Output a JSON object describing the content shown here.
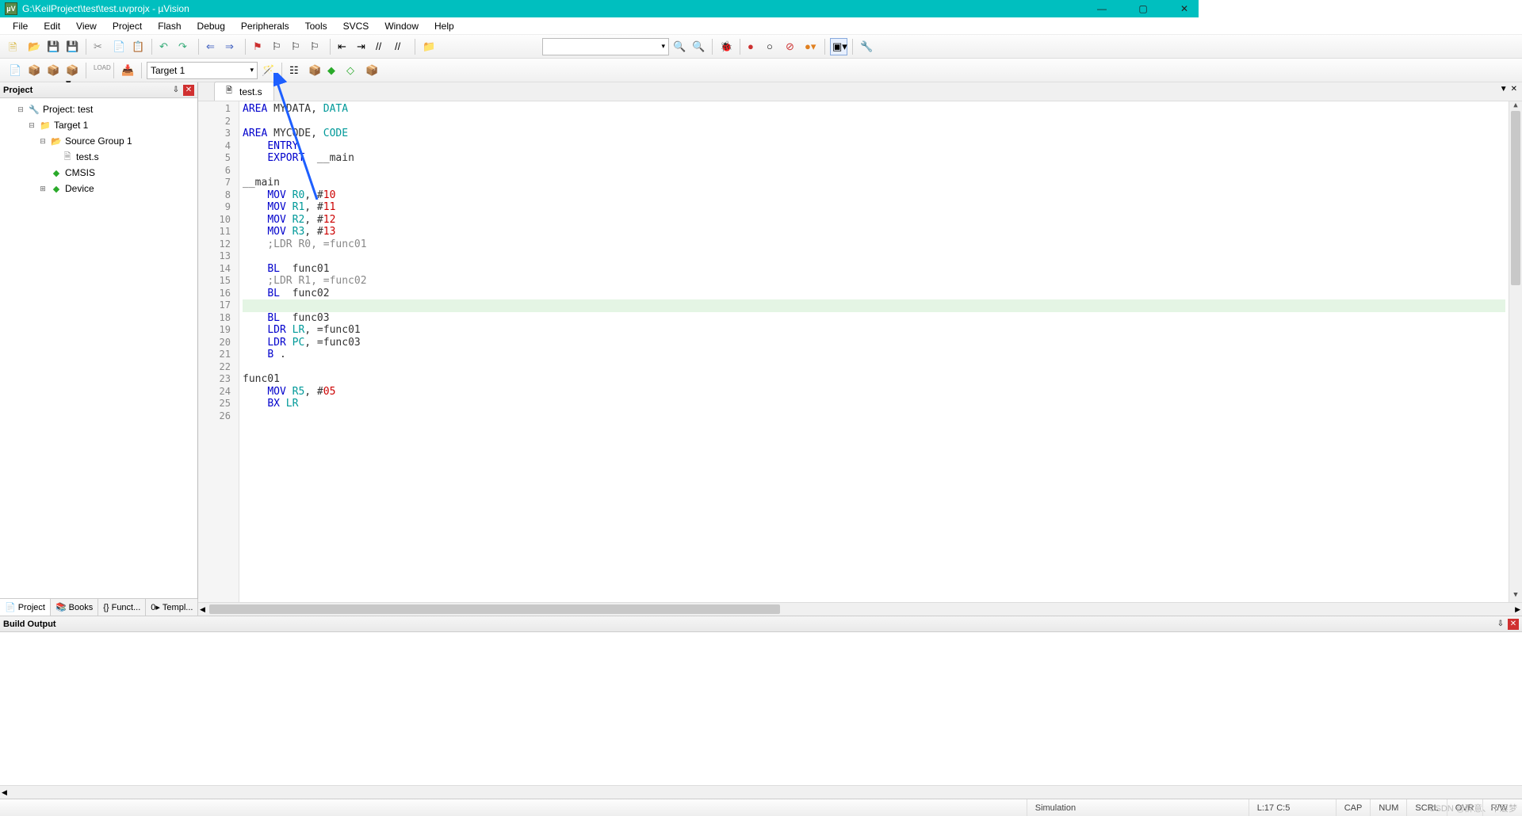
{
  "window": {
    "title": "G:\\KeilProject\\test\\test.uvprojx - µVision",
    "app_icon_label": "µV"
  },
  "menubar": {
    "items": [
      "File",
      "Edit",
      "View",
      "Project",
      "Flash",
      "Debug",
      "Peripherals",
      "Tools",
      "SVCS",
      "Window",
      "Help"
    ]
  },
  "toolbar2": {
    "target_combo": "Target 1"
  },
  "project_panel": {
    "title": "Project",
    "tree_root": "Project: test",
    "target": "Target 1",
    "group": "Source Group 1",
    "file": "test.s",
    "cmsis": "CMSIS",
    "device": "Device",
    "bottom_tabs": [
      "Project",
      "Books",
      "Funct...",
      "Templ..."
    ]
  },
  "editor": {
    "filename": "test.s",
    "highlighted_line": 17,
    "code_lines": [
      {
        "n": 1,
        "segs": [
          {
            "c": "kw-blue",
            "t": "AREA"
          },
          {
            "t": " MYDATA, "
          },
          {
            "c": "kw-teal",
            "t": "DATA"
          }
        ]
      },
      {
        "n": 2,
        "segs": []
      },
      {
        "n": 3,
        "segs": [
          {
            "c": "kw-blue",
            "t": "AREA"
          },
          {
            "t": " MYCODE, "
          },
          {
            "c": "kw-teal",
            "t": "CODE"
          }
        ]
      },
      {
        "n": 4,
        "segs": [
          {
            "t": "    "
          },
          {
            "c": "kw-blue",
            "t": "ENTRY"
          }
        ]
      },
      {
        "n": 5,
        "segs": [
          {
            "t": "    "
          },
          {
            "c": "kw-blue",
            "t": "EXPORT"
          },
          {
            "t": "  __main"
          }
        ]
      },
      {
        "n": 6,
        "segs": []
      },
      {
        "n": 7,
        "segs": [
          {
            "t": "__main"
          }
        ]
      },
      {
        "n": 8,
        "segs": [
          {
            "t": "    "
          },
          {
            "c": "kw-blue",
            "t": "MOV"
          },
          {
            "t": " "
          },
          {
            "c": "kw-teal",
            "t": "R0"
          },
          {
            "t": ", #"
          },
          {
            "c": "kw-num",
            "t": "10"
          }
        ]
      },
      {
        "n": 9,
        "segs": [
          {
            "t": "    "
          },
          {
            "c": "kw-blue",
            "t": "MOV"
          },
          {
            "t": " "
          },
          {
            "c": "kw-teal",
            "t": "R1"
          },
          {
            "t": ", #"
          },
          {
            "c": "kw-num",
            "t": "11"
          }
        ]
      },
      {
        "n": 10,
        "segs": [
          {
            "t": "    "
          },
          {
            "c": "kw-blue",
            "t": "MOV"
          },
          {
            "t": " "
          },
          {
            "c": "kw-teal",
            "t": "R2"
          },
          {
            "t": ", #"
          },
          {
            "c": "kw-num",
            "t": "12"
          }
        ]
      },
      {
        "n": 11,
        "segs": [
          {
            "t": "    "
          },
          {
            "c": "kw-blue",
            "t": "MOV"
          },
          {
            "t": " "
          },
          {
            "c": "kw-teal",
            "t": "R3"
          },
          {
            "t": ", #"
          },
          {
            "c": "kw-num",
            "t": "13"
          }
        ]
      },
      {
        "n": 12,
        "segs": [
          {
            "t": "    "
          },
          {
            "c": "kw-comment",
            "t": ";LDR R0, =func01"
          }
        ]
      },
      {
        "n": 13,
        "segs": []
      },
      {
        "n": 14,
        "segs": [
          {
            "t": "    "
          },
          {
            "c": "kw-blue",
            "t": "BL"
          },
          {
            "t": "  func01"
          }
        ]
      },
      {
        "n": 15,
        "segs": [
          {
            "t": "    "
          },
          {
            "c": "kw-comment",
            "t": ";LDR R1, =func02"
          }
        ]
      },
      {
        "n": 16,
        "segs": [
          {
            "t": "    "
          },
          {
            "c": "kw-blue",
            "t": "BL"
          },
          {
            "t": "  func02"
          }
        ]
      },
      {
        "n": 17,
        "segs": [
          {
            "t": "    "
          }
        ]
      },
      {
        "n": 18,
        "segs": [
          {
            "t": "    "
          },
          {
            "c": "kw-blue",
            "t": "BL"
          },
          {
            "t": "  func03"
          }
        ]
      },
      {
        "n": 19,
        "segs": [
          {
            "t": "    "
          },
          {
            "c": "kw-blue",
            "t": "LDR"
          },
          {
            "t": " "
          },
          {
            "c": "kw-teal",
            "t": "LR"
          },
          {
            "t": ", =func01"
          }
        ]
      },
      {
        "n": 20,
        "segs": [
          {
            "t": "    "
          },
          {
            "c": "kw-blue",
            "t": "LDR"
          },
          {
            "t": " "
          },
          {
            "c": "kw-teal",
            "t": "PC"
          },
          {
            "t": ", =func03"
          }
        ]
      },
      {
        "n": 21,
        "segs": [
          {
            "t": "    "
          },
          {
            "c": "kw-blue",
            "t": "B"
          },
          {
            "t": " ."
          }
        ]
      },
      {
        "n": 22,
        "segs": []
      },
      {
        "n": 23,
        "segs": [
          {
            "t": "func01"
          }
        ]
      },
      {
        "n": 24,
        "segs": [
          {
            "t": "    "
          },
          {
            "c": "kw-blue",
            "t": "MOV"
          },
          {
            "t": " "
          },
          {
            "c": "kw-teal",
            "t": "R5"
          },
          {
            "t": ", #"
          },
          {
            "c": "kw-num",
            "t": "05"
          }
        ]
      },
      {
        "n": 25,
        "segs": [
          {
            "t": "    "
          },
          {
            "c": "kw-blue",
            "t": "BX"
          },
          {
            "t": " "
          },
          {
            "c": "kw-teal",
            "t": "LR"
          }
        ]
      },
      {
        "n": 26,
        "segs": []
      }
    ]
  },
  "build_output": {
    "title": "Build Output"
  },
  "statusbar": {
    "simulation": "Simulation",
    "pos": "L:17 C:5",
    "indicators": [
      "CAP",
      "NUM",
      "SCRL",
      "OVR",
      "R/W"
    ]
  },
  "watermark": "CSDN @醉意、千层梦"
}
